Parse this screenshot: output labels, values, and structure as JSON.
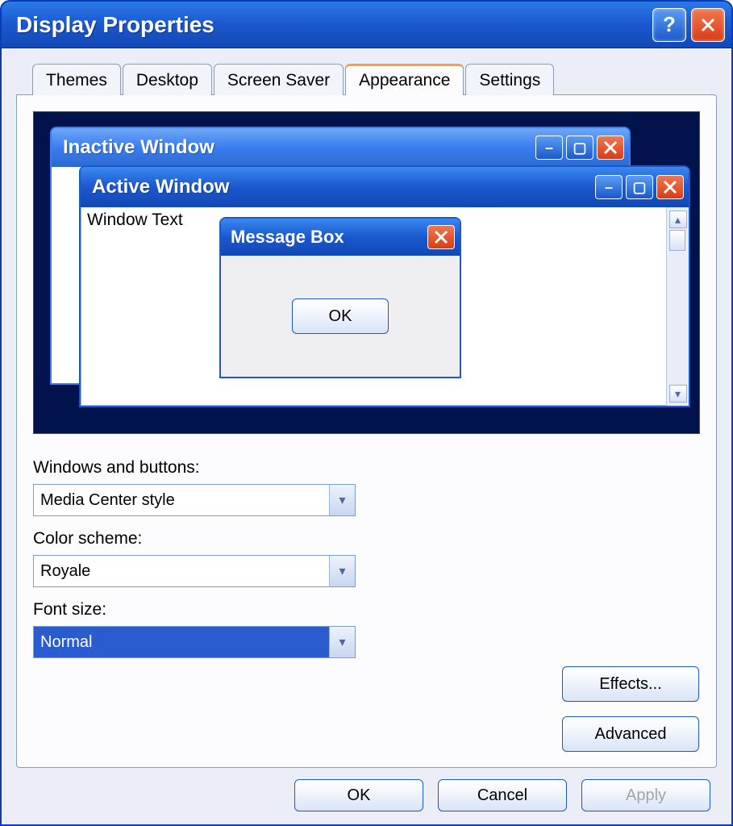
{
  "dialog": {
    "title": "Display Properties"
  },
  "tabs": [
    {
      "label": "Themes"
    },
    {
      "label": "Desktop"
    },
    {
      "label": "Screen Saver"
    },
    {
      "label": "Appearance",
      "active": true
    },
    {
      "label": "Settings"
    }
  ],
  "preview": {
    "inactive_title": "Inactive Window",
    "active_title": "Active Window",
    "window_text": "Window Text",
    "msgbox_title": "Message Box",
    "msgbox_ok": "OK"
  },
  "fields": {
    "windows_buttons_label": "Windows and buttons:",
    "windows_buttons_value": "Media Center style",
    "color_scheme_label": "Color scheme:",
    "color_scheme_value": "Royale",
    "font_size_label": "Font size:",
    "font_size_value": "Normal"
  },
  "buttons": {
    "effects": "Effects...",
    "advanced": "Advanced",
    "ok": "OK",
    "cancel": "Cancel",
    "apply": "Apply"
  }
}
